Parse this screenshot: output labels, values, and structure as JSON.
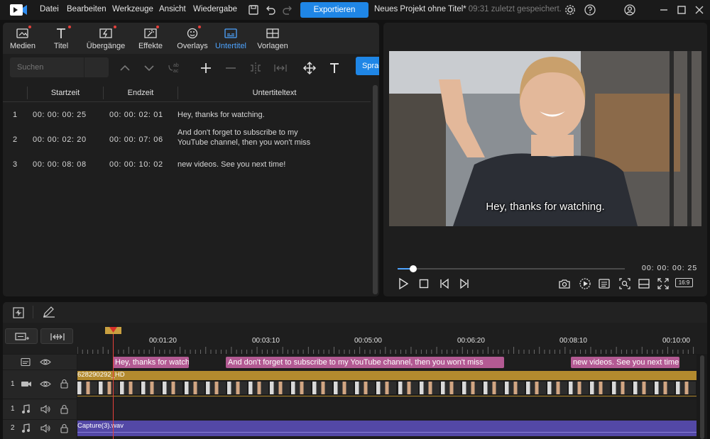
{
  "menu": {
    "items": [
      "Datei",
      "Bearbeiten",
      "Werkzeuge",
      "Ansicht",
      "Wiedergabe"
    ],
    "export_label": "Exportieren",
    "project_title": "Neues Projekt ohne Titel*",
    "saved_status": "09:31 zuletzt gespeichert."
  },
  "tabs": [
    {
      "label": "Medien",
      "icon": "media-icon",
      "dot": true,
      "active": false
    },
    {
      "label": "Titel",
      "icon": "title-icon",
      "dot": true,
      "active": false
    },
    {
      "label": "Übergänge",
      "icon": "transitions-icon",
      "dot": true,
      "active": false
    },
    {
      "label": "Effekte",
      "icon": "effects-icon",
      "dot": true,
      "active": false
    },
    {
      "label": "Overlays",
      "icon": "overlays-icon",
      "dot": true,
      "active": false
    },
    {
      "label": "Untertitel",
      "icon": "subtitles-icon",
      "dot": false,
      "active": true
    },
    {
      "label": "Vorlagen",
      "icon": "templates-icon",
      "dot": false,
      "active": false
    }
  ],
  "search": {
    "placeholder": "Suchen"
  },
  "lang_button": "Sprac",
  "subtitle_table": {
    "headers": [
      "Startzeit",
      "Endzeit",
      "Untertiteltext"
    ],
    "rows": [
      {
        "num": "1",
        "start": "00: 00: 00: 25",
        "end": "00: 00: 02: 01",
        "text": "Hey, thanks for watching."
      },
      {
        "num": "2",
        "start": "00: 00: 02: 20",
        "end": "00: 00: 07: 06",
        "text": "And don't forget to subscribe to my YouTube channel, then you won't miss"
      },
      {
        "num": "3",
        "start": "00: 00: 08: 08",
        "end": "00: 00: 10: 02",
        "text": "new videos. See you next time!"
      }
    ]
  },
  "preview": {
    "subtitle_overlay": "Hey, thanks for watching.",
    "timecode": "00: 00: 00: 25",
    "progress": 0.07,
    "aspect_ratio": "16:9"
  },
  "timeline": {
    "ticks": [
      "00:01:20",
      "00:03:10",
      "00:05:00",
      "00:06:20",
      "00:08:10",
      "00:10:00"
    ],
    "subtitle_clips": [
      "Hey, thanks for watch",
      "And don't forget to subscribe to my  YouTube channel, then you won't miss",
      "new videos. See you next time!"
    ],
    "video_track_num": "1",
    "video_clip_name": "628290292_HD",
    "audio_track1_num": "1",
    "audio_track2_num": "2",
    "audio_clip_name": "Capture(3).wav"
  },
  "colors": {
    "accent": "#1f86e6",
    "subtitle_clip": "#b35a93",
    "video_clip": "#b38a2e",
    "audio_clip": "#5348a6",
    "playhead": "#e5403b"
  }
}
